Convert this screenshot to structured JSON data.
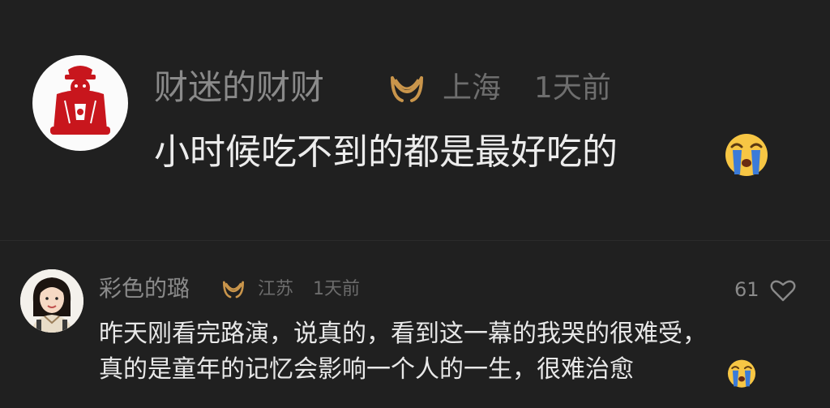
{
  "comments": [
    {
      "username": "财迷的财财",
      "location": "上海",
      "time": "1天前",
      "text": "小时候吃不到的都是最好吃的",
      "emoji_icon": "crying-face-icon",
      "badge_icon": "vip-badge-icon"
    },
    {
      "username": "彩色的璐",
      "location": "江苏",
      "time": "1天前",
      "likes": "61",
      "text_lines": [
        "昨天刚看完路演，说真的，看到这一幕的我哭的很难受，",
        "真的是童年的记忆会影响一个人的一生，很难治愈"
      ],
      "emoji_icon": "crying-face-icon",
      "badge_icon": "vip-badge-icon"
    }
  ],
  "colors": {
    "background": "#202020",
    "username": "#8a8a8a",
    "meta": "#6e6e6e",
    "text": "#ececec",
    "badge": "#c9954b",
    "avatar_red": "#c8161d"
  }
}
